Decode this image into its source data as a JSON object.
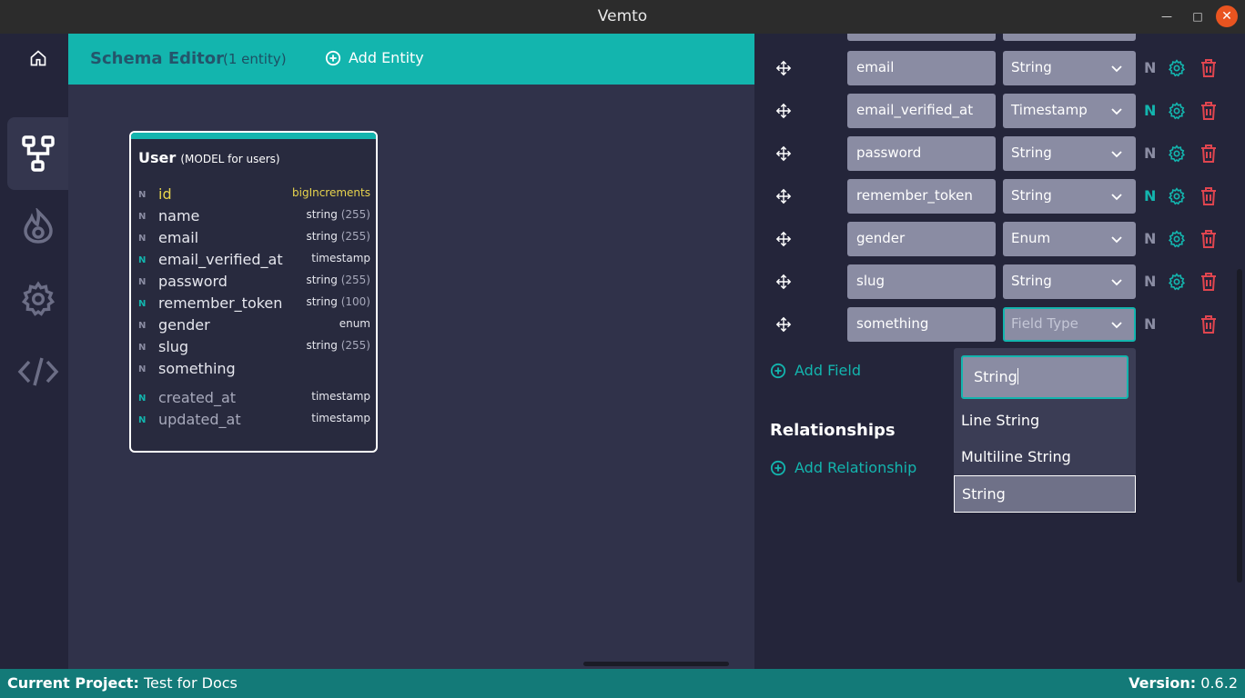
{
  "window": {
    "title": "Vemto"
  },
  "header": {
    "title": "Schema Editor",
    "count": "(1 entity)",
    "add_entity": "Add Entity"
  },
  "entity": {
    "name": "User",
    "subtitle": "(MODEL for users)",
    "fields": [
      {
        "n": "N",
        "name": "id",
        "type": "bigIncrements",
        "len": ""
      },
      {
        "n": "N",
        "name": "name",
        "type": "string",
        "len": "(255)"
      },
      {
        "n": "N",
        "name": "email",
        "type": "string",
        "len": "(255)"
      },
      {
        "n": "N",
        "name": "email_verified_at",
        "type": "timestamp",
        "len": ""
      },
      {
        "n": "N",
        "name": "password",
        "type": "string",
        "len": "(255)"
      },
      {
        "n": "N",
        "name": "remember_token",
        "type": "string",
        "len": "(100)"
      },
      {
        "n": "N",
        "name": "gender",
        "type": "enum",
        "len": ""
      },
      {
        "n": "N",
        "name": "slug",
        "type": "string",
        "len": "(255)"
      },
      {
        "n": "N",
        "name": "something",
        "type": "",
        "len": ""
      },
      {
        "n": "N",
        "name": "created_at",
        "type": "timestamp",
        "len": ""
      },
      {
        "n": "N",
        "name": "updated_at",
        "type": "timestamp",
        "len": ""
      }
    ]
  },
  "panel": {
    "rows": [
      {
        "name": "email",
        "type": "String",
        "n": "N"
      },
      {
        "name": "email_verified_at",
        "type": "Timestamp",
        "n": "N"
      },
      {
        "name": "password",
        "type": "String",
        "n": "N"
      },
      {
        "name": "remember_token",
        "type": "String",
        "n": "N"
      },
      {
        "name": "gender",
        "type": "Enum",
        "n": "N"
      },
      {
        "name": "slug",
        "type": "String",
        "n": "N"
      },
      {
        "name": "something",
        "type": "Field Type",
        "n": "N"
      }
    ],
    "add_field": "Add Field",
    "relationships_title": "Relationships",
    "add_relationship": "Add Relationship",
    "dropdown": {
      "search_value": "String",
      "options": [
        "Line String",
        "Multiline String",
        "String"
      ]
    }
  },
  "status": {
    "project_label": "Current Project:",
    "project_name": "Test for Docs",
    "version_label": "Version:",
    "version": "0.6.2"
  },
  "colors": {
    "accent": "#13b5ae",
    "danger": "#e0454f",
    "status_bar": "#137a78"
  }
}
